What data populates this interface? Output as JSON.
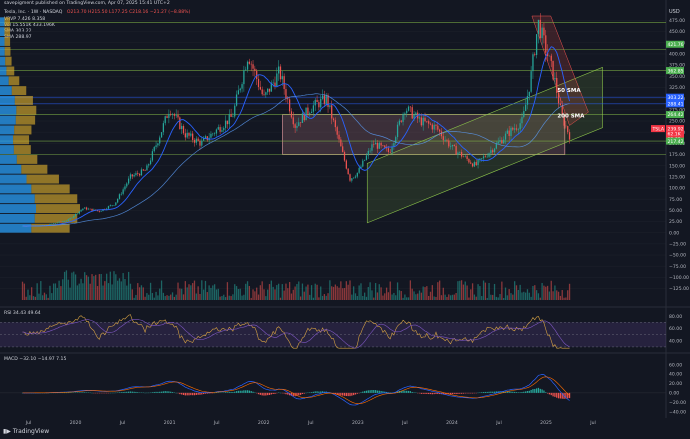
{
  "publisher": "savepigment published on TradingView.com, Apr 07, 2025 15:41 UTC+2",
  "brand": "TradingView",
  "chart_data": {
    "type": "line",
    "symbol_line": "Tesla, Inc. · 1W · NASDAQ",
    "ohlc_text": "O213.70 H215.50 L177.25 C218.16 −21.27 (−8.88%)",
    "legend": {
      "vrvp": "VRVP  7.426  8.358",
      "vol": "Vol  15.551K  433.196K",
      "sma1": "SMA  303.22",
      "sma2": "SMA  288.97"
    },
    "currency": "USD",
    "y_ticks": [
      "475.00",
      "450.00",
      "425.00",
      "400.00",
      "375.00",
      "350.00",
      "325.00",
      "300.00",
      "275.00",
      "250.00",
      "225.00",
      "200.00",
      "175.00",
      "150.00",
      "125.00",
      "100.00",
      "75.00",
      "50.00",
      "25.00",
      "0.00",
      "−25.00",
      "−50.00",
      "−75.00",
      "−100.00",
      "−125.00"
    ],
    "ylim": [
      -135,
      485
    ],
    "x_ticks": [
      "Jul",
      "2020",
      "Jul",
      "2021",
      "Jul",
      "2022",
      "Jul",
      "2023",
      "Jul",
      "2024",
      "Jul",
      "2025",
      "Jul"
    ],
    "price_labels": [
      {
        "text": "421.76",
        "value": 421.76,
        "color": "#4caf50"
      },
      {
        "text": "362.85",
        "value": 362.85,
        "color": "#4caf50"
      },
      {
        "text": "303.22",
        "value": 303.22,
        "color": "#2962ff"
      },
      {
        "text": "288.41",
        "value": 288.41,
        "color": "#2962ff"
      },
      {
        "text": "264.42",
        "value": 264.42,
        "color": "#4caf50"
      },
      {
        "text": "TSLA",
        "value": 233,
        "color": "#f23645"
      },
      {
        "text": "239.92",
        "value": 233,
        "color": "#f23645"
      },
      {
        "text": "62.1K",
        "value": 221,
        "color": "#f23645"
      },
      {
        "text": "33:05",
        "value": 210,
        "color": "#f23645"
      },
      {
        "text": "217.42",
        "value": 205,
        "color": "#4caf50"
      }
    ],
    "annotations": [
      {
        "text": "50 SMA",
        "value": 315
      },
      {
        "text": "200 SMA",
        "value": 258
      }
    ],
    "horizontal_levels": [
      470,
      410,
      362.85,
      303.22,
      288.41,
      264.42,
      205,
      175
    ],
    "price": [
      {
        "x": "2019-06",
        "c": 15
      },
      {
        "x": "2019-09",
        "c": 16
      },
      {
        "x": "2019-12",
        "c": 28
      },
      {
        "x": "2020-02",
        "c": 55
      },
      {
        "x": "2020-04",
        "c": 48
      },
      {
        "x": "2020-06",
        "c": 65
      },
      {
        "x": "2020-08",
        "c": 125
      },
      {
        "x": "2020-10",
        "c": 140
      },
      {
        "x": "2020-12",
        "c": 230
      },
      {
        "x": "2021-01",
        "c": 280
      },
      {
        "x": "2021-03",
        "c": 220
      },
      {
        "x": "2021-05",
        "c": 200
      },
      {
        "x": "2021-07",
        "c": 230
      },
      {
        "x": "2021-09",
        "c": 260
      },
      {
        "x": "2021-11",
        "c": 400
      },
      {
        "x": "2021-12",
        "c": 350
      },
      {
        "x": "2022-01",
        "c": 300
      },
      {
        "x": "2022-03",
        "c": 360
      },
      {
        "x": "2022-05",
        "c": 240
      },
      {
        "x": "2022-07",
        "c": 280
      },
      {
        "x": "2022-09",
        "c": 300
      },
      {
        "x": "2022-11",
        "c": 180
      },
      {
        "x": "2022-12",
        "c": 120
      },
      {
        "x": "2023-01",
        "c": 135
      },
      {
        "x": "2023-03",
        "c": 200
      },
      {
        "x": "2023-05",
        "c": 180
      },
      {
        "x": "2023-07",
        "c": 280
      },
      {
        "x": "2023-09",
        "c": 250
      },
      {
        "x": "2023-11",
        "c": 235
      },
      {
        "x": "2024-01",
        "c": 190
      },
      {
        "x": "2024-04",
        "c": 150
      },
      {
        "x": "2024-06",
        "c": 185
      },
      {
        "x": "2024-08",
        "c": 220
      },
      {
        "x": "2024-10",
        "c": 250
      },
      {
        "x": "2024-11",
        "c": 340
      },
      {
        "x": "2024-12",
        "c": 470
      },
      {
        "x": "2025-01",
        "c": 410
      },
      {
        "x": "2025-02",
        "c": 350
      },
      {
        "x": "2025-03",
        "c": 260
      },
      {
        "x": "2025-04",
        "c": 218
      }
    ],
    "rsi": {
      "label": "RSI  34.43  49.64",
      "ticks": [
        "80.00",
        "60.00",
        "40.00"
      ],
      "band": [
        30,
        70
      ]
    },
    "macd": {
      "label": "MACD  −32.10  −14.97  7.15",
      "ticks": [
        "60.00",
        "40.00",
        "20.00",
        "0.00",
        "−20.00",
        "−40.00"
      ]
    },
    "colors": {
      "up": "#26a69a",
      "down": "#ef5350",
      "sma50": "#2962ff",
      "sma200": "#5b9cf6",
      "level": "#8bc34a",
      "channel": "#8bc34a",
      "range_box": "#f2a3a8",
      "vp_up": "#2a9df4",
      "vp_down": "#d4a72c"
    }
  }
}
